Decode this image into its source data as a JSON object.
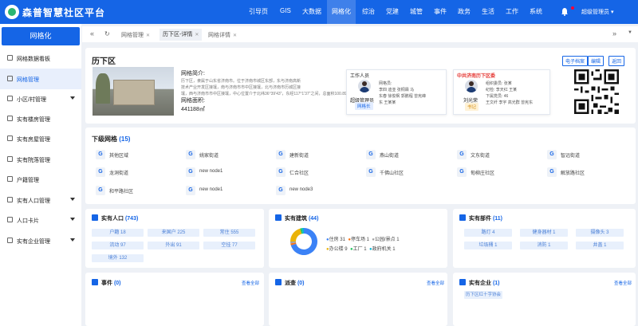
{
  "app": {
    "title": "森普智慧社区平台",
    "user": "超级管理员"
  },
  "nav": {
    "items": [
      "引导页",
      "GIS",
      "大数据",
      "网格化",
      "综治",
      "党建",
      "城管",
      "事件",
      "政务",
      "生活",
      "工作",
      "系统"
    ],
    "active": 3
  },
  "sidebar": {
    "header": "网格化",
    "items": [
      {
        "label": "网格数据看板",
        "expand": false
      },
      {
        "label": "网格管理",
        "expand": false
      },
      {
        "label": "小区/村管理",
        "expand": true
      },
      {
        "label": "实有楼房管理",
        "expand": false
      },
      {
        "label": "实有房屋管理",
        "expand": false
      },
      {
        "label": "实有院落管理",
        "expand": false
      },
      {
        "label": "户籍管理",
        "expand": false
      },
      {
        "label": "实有人口管理",
        "expand": true
      },
      {
        "label": "人口卡片",
        "expand": true
      },
      {
        "label": "实有企业管理",
        "expand": true
      }
    ]
  },
  "tabs": [
    "网格管理",
    "历下区-详情",
    "网格详情"
  ],
  "detail": {
    "name": "历下区",
    "intro_label": "网格简介:",
    "intro_lines": [
      "历下区，隶属于山东省济南市。位于济南市城区东部，东与济南高新",
      "技术产业开发区接壤，南与济南市市中区接壤，北与济南市历城区接",
      "壤，西与济南市市中区接壤，中心位置介于北纬36°39'43\"，东经117°1'37\"之间，总面积100.89平方千米。历"
    ],
    "area_label": "网格面积:",
    "area": "441188㎡",
    "buttons": [
      "电子档案",
      "编辑",
      "返回"
    ]
  },
  "staff": {
    "title": "工作人员",
    "name": "超级管理员",
    "role": "网格长",
    "lines": [
      "网格员:",
      "李四 迪亚 张桐霖 马",
      "东春 徐俊枫 郭鹏程 曾宪峰",
      "东 王某某"
    ]
  },
  "party": {
    "title": "中共济南历下区委",
    "name": "刘光荣",
    "role": "书记",
    "lines": [
      "组织委员: 张某",
      "纪检: 李天红 王某",
      "下属党员: 46",
      "王文纤 李宇 高光群 曾宪东"
    ]
  },
  "sub": {
    "title": "下级网格",
    "count": "(15)",
    "items": [
      "其他区域",
      "姚家街道",
      "建新街道",
      "燕山街道",
      "文东街道",
      "智远街道",
      "龙洞街道",
      "new node1",
      "仁合社区",
      "千佛山社区",
      "甸柳庄社区",
      "解放路社区",
      "和平路社区",
      "new node1",
      "new node3"
    ]
  },
  "population": {
    "title": "实有人口",
    "count": "(743)",
    "chips": [
      "户籍 18",
      "来国户 225",
      "常住 555",
      "流动 97",
      "外出 91",
      "空挂 77",
      "境外 132"
    ]
  },
  "buildings": {
    "title": "实有建筑",
    "count": "(44)",
    "legend": [
      {
        "label": "住房 31",
        "color": "#3b82f6"
      },
      {
        "label": "停车场 1",
        "color": "#f97316"
      },
      {
        "label": "公园/景点 1",
        "color": "#a3a3a3"
      },
      {
        "label": "办公楼 9",
        "color": "#eab308"
      },
      {
        "label": "工厂 1",
        "color": "#22c55e"
      },
      {
        "label": "政府机关 1",
        "color": "#06b6d4"
      }
    ]
  },
  "facilities": {
    "title": "实有部件",
    "count": "(11)",
    "chips": [
      "路灯 4",
      "健身器材 1",
      "摄像头 3",
      "垃圾桶 1",
      "消防 1",
      "井盖 1"
    ]
  },
  "events": {
    "title": "事件",
    "count": "(0)",
    "more": "查看全部"
  },
  "tasks": {
    "title": "派查",
    "count": "(0)",
    "more": "查看全部"
  },
  "enterprise": {
    "title": "实有企业",
    "count": "(1)",
    "more": "查看全部",
    "items": [
      "历下区红十字协会"
    ]
  },
  "colors": {
    "primary": "#1565e6",
    "accent_red": "#e53935",
    "sidebar_selected": "#e8effc"
  }
}
